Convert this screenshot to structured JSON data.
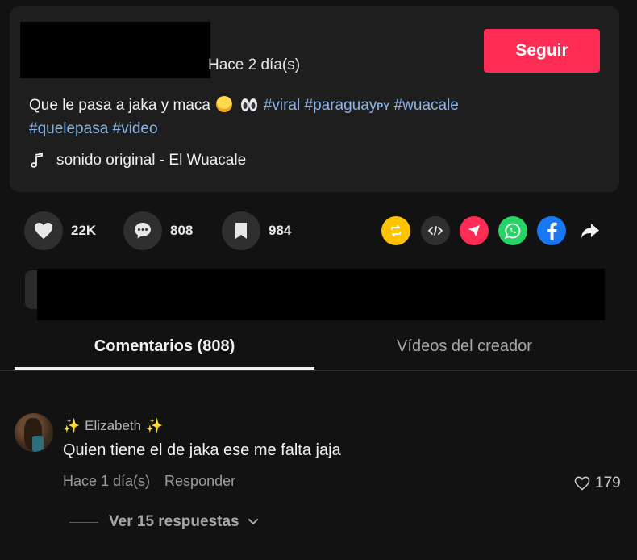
{
  "post": {
    "time": "Hace 2 día(s)",
    "follow_label": "Seguir",
    "caption_text": "Que le pasa a jaka y maca",
    "hashtags": [
      "#viral",
      "#paraguay",
      "#wuacale",
      "#quelepasa",
      "#video"
    ],
    "hashtag_suffix": "PY",
    "sound": "sonido original - El Wuacale"
  },
  "actions": {
    "likes": "22K",
    "comments": "808",
    "saves": "984"
  },
  "share_icons": [
    "repost-icon",
    "embed-icon",
    "send-icon",
    "whatsapp-icon",
    "facebook-icon",
    "share-arrow-icon"
  ],
  "colors": {
    "accent": "#fe2c55",
    "hashtag": "#8ab4e8",
    "repost": "#ffc300",
    "whatsapp": "#25d366",
    "facebook": "#1877f2"
  },
  "tabs": {
    "comments": "Comentarios (808)",
    "creator_videos": "Vídeos del creador"
  },
  "comment": {
    "sparkle_left": "✨",
    "username": "Elizabeth",
    "sparkle_right": "✨",
    "text": "Quien tiene el de jaka ese me falta jaja",
    "time": "Hace 1 día(s)",
    "reply_label": "Responder",
    "likes": "179",
    "view_replies": "Ver 15 respuestas"
  }
}
